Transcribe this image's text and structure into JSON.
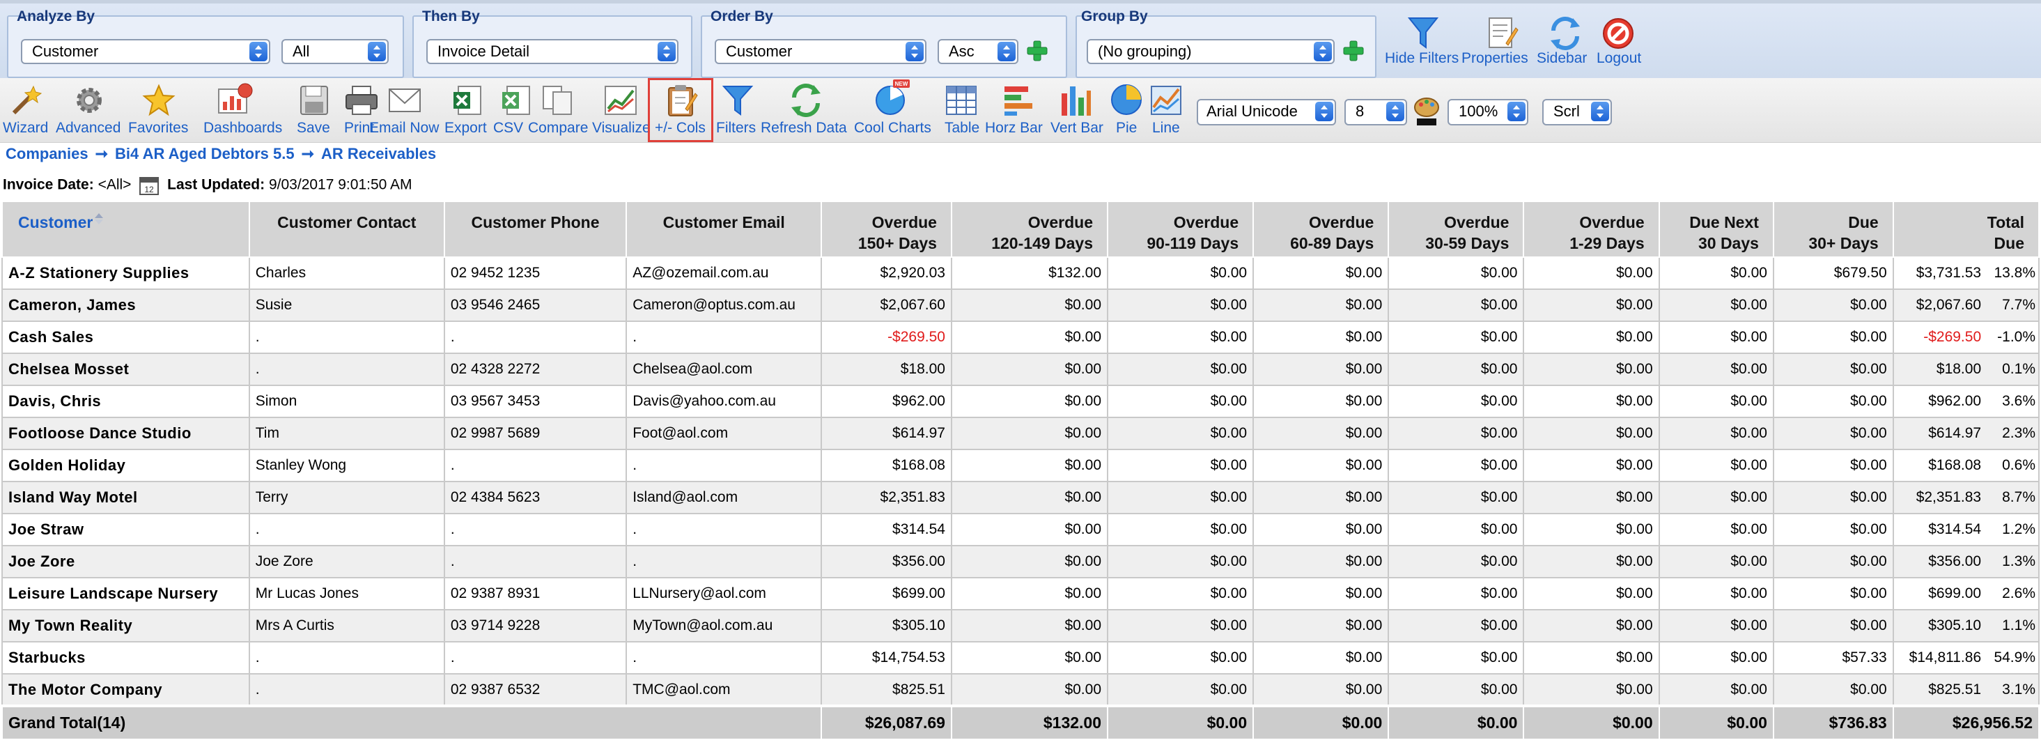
{
  "filters": {
    "analyze_by": {
      "title": "Analyze By",
      "field": "Customer",
      "value": "All"
    },
    "then_by": {
      "title": "Then By",
      "field": "Invoice Detail"
    },
    "order_by": {
      "title": "Order By",
      "field": "Customer",
      "direction": "Asc"
    },
    "group_by": {
      "title": "Group By",
      "field": "(No grouping)"
    }
  },
  "top_actions": [
    "Hide Filters",
    "Properties",
    "Sidebar",
    "Logout"
  ],
  "toolbar": {
    "wizard": "Wizard",
    "advanced": "Advanced",
    "favorites": "Favorites",
    "dashboards": "Dashboards",
    "save": "Save",
    "print": "Print",
    "email_now": "Email Now",
    "export": "Export",
    "csv": "CSV",
    "compare": "Compare",
    "visualize": "Visualize",
    "cols": "+/- Cols",
    "filters": "Filters",
    "refresh": "Refresh Data",
    "cool_charts": "Cool Charts",
    "table": "Table",
    "horz_bar": "Horz Bar",
    "vert_bar": "Vert Bar",
    "pie": "Pie",
    "line": "Line",
    "font": "Arial Unicode",
    "font_size": "8",
    "zoom": "100%",
    "scroll": "Scrl",
    "new_badge": "NEW"
  },
  "breadcrumb": [
    "Companies",
    "Bi4 AR Aged Debtors 5.5",
    "AR Receivables"
  ],
  "info": {
    "invoice_date_label": "Invoice Date:",
    "invoice_date_value": "<All>",
    "last_updated_label": "Last Updated:",
    "last_updated_value": "9/03/2017 9:01:50 AM"
  },
  "columns": [
    [
      "Customer"
    ],
    [
      "Customer Contact"
    ],
    [
      "Customer Phone"
    ],
    [
      "Customer Email"
    ],
    [
      "Overdue",
      "150+ Days"
    ],
    [
      "Overdue",
      "120-149 Days"
    ],
    [
      "Overdue",
      "90-119 Days"
    ],
    [
      "Overdue",
      "60-89 Days"
    ],
    [
      "Overdue",
      "30-59 Days"
    ],
    [
      "Overdue",
      "1-29 Days"
    ],
    [
      "Due Next",
      "30 Days"
    ],
    [
      "Due",
      "30+ Days"
    ],
    [
      "Total",
      "Due"
    ]
  ],
  "rows": [
    {
      "customer": "A-Z Stationery Supplies",
      "contact": "Charles",
      "phone": "02 9452 1235",
      "email": "AZ@ozemail.com.au",
      "d150": "$2,920.03",
      "d120": "$132.00",
      "d90": "$0.00",
      "d60": "$0.00",
      "d30": "$0.00",
      "d1": "$0.00",
      "next30": "$0.00",
      "due30": "$679.50",
      "total": "$3,731.53",
      "pct": "13.8%"
    },
    {
      "customer": "Cameron, James",
      "contact": "Susie",
      "phone": "03 9546 2465",
      "email": "Cameron@optus.com.au",
      "d150": "$2,067.60",
      "d120": "$0.00",
      "d90": "$0.00",
      "d60": "$0.00",
      "d30": "$0.00",
      "d1": "$0.00",
      "next30": "$0.00",
      "due30": "$0.00",
      "total": "$2,067.60",
      "pct": "7.7%"
    },
    {
      "customer": "Cash Sales",
      "contact": ".",
      "phone": ".",
      "email": ".",
      "d150": "-$269.50",
      "d120": "$0.00",
      "d90": "$0.00",
      "d60": "$0.00",
      "d30": "$0.00",
      "d1": "$0.00",
      "next30": "$0.00",
      "due30": "$0.00",
      "total": "-$269.50",
      "pct": "-1.0%",
      "negative": true
    },
    {
      "customer": "Chelsea Mosset",
      "contact": ".",
      "phone": "02 4328 2272",
      "email": "Chelsea@aol.com",
      "d150": "$18.00",
      "d120": "$0.00",
      "d90": "$0.00",
      "d60": "$0.00",
      "d30": "$0.00",
      "d1": "$0.00",
      "next30": "$0.00",
      "due30": "$0.00",
      "total": "$18.00",
      "pct": "0.1%"
    },
    {
      "customer": "Davis, Chris",
      "contact": "Simon",
      "phone": "03 9567 3453",
      "email": "Davis@yahoo.com.au",
      "d150": "$962.00",
      "d120": "$0.00",
      "d90": "$0.00",
      "d60": "$0.00",
      "d30": "$0.00",
      "d1": "$0.00",
      "next30": "$0.00",
      "due30": "$0.00",
      "total": "$962.00",
      "pct": "3.6%"
    },
    {
      "customer": "Footloose Dance Studio",
      "contact": "Tim",
      "phone": "02 9987 5689",
      "email": "Foot@aol.com",
      "d150": "$614.97",
      "d120": "$0.00",
      "d90": "$0.00",
      "d60": "$0.00",
      "d30": "$0.00",
      "d1": "$0.00",
      "next30": "$0.00",
      "due30": "$0.00",
      "total": "$614.97",
      "pct": "2.3%"
    },
    {
      "customer": "Golden Holiday",
      "contact": "Stanley Wong",
      "phone": ".",
      "email": ".",
      "d150": "$168.08",
      "d120": "$0.00",
      "d90": "$0.00",
      "d60": "$0.00",
      "d30": "$0.00",
      "d1": "$0.00",
      "next30": "$0.00",
      "due30": "$0.00",
      "total": "$168.08",
      "pct": "0.6%"
    },
    {
      "customer": "Island Way Motel",
      "contact": "Terry",
      "phone": "02 4384 5623",
      "email": "Island@aol.com",
      "d150": "$2,351.83",
      "d120": "$0.00",
      "d90": "$0.00",
      "d60": "$0.00",
      "d30": "$0.00",
      "d1": "$0.00",
      "next30": "$0.00",
      "due30": "$0.00",
      "total": "$2,351.83",
      "pct": "8.7%"
    },
    {
      "customer": "Joe Straw",
      "contact": ".",
      "phone": ".",
      "email": ".",
      "d150": "$314.54",
      "d120": "$0.00",
      "d90": "$0.00",
      "d60": "$0.00",
      "d30": "$0.00",
      "d1": "$0.00",
      "next30": "$0.00",
      "due30": "$0.00",
      "total": "$314.54",
      "pct": "1.2%"
    },
    {
      "customer": "Joe Zore",
      "contact": "Joe Zore",
      "phone": ".",
      "email": ".",
      "d150": "$356.00",
      "d120": "$0.00",
      "d90": "$0.00",
      "d60": "$0.00",
      "d30": "$0.00",
      "d1": "$0.00",
      "next30": "$0.00",
      "due30": "$0.00",
      "total": "$356.00",
      "pct": "1.3%"
    },
    {
      "customer": "Leisure Landscape Nursery",
      "contact": "Mr Lucas Jones",
      "phone": "02 9387 8931",
      "email": "LLNursery@aol.com",
      "d150": "$699.00",
      "d120": "$0.00",
      "d90": "$0.00",
      "d60": "$0.00",
      "d30": "$0.00",
      "d1": "$0.00",
      "next30": "$0.00",
      "due30": "$0.00",
      "total": "$699.00",
      "pct": "2.6%"
    },
    {
      "customer": "My Town Reality",
      "contact": "Mrs A Curtis",
      "phone": "03 9714 9228",
      "email": "MyTown@aol.com.au",
      "d150": "$305.10",
      "d120": "$0.00",
      "d90": "$0.00",
      "d60": "$0.00",
      "d30": "$0.00",
      "d1": "$0.00",
      "next30": "$0.00",
      "due30": "$0.00",
      "total": "$305.10",
      "pct": "1.1%"
    },
    {
      "customer": "Starbucks",
      "contact": ".",
      "phone": ".",
      "email": ".",
      "d150": "$14,754.53",
      "d120": "$0.00",
      "d90": "$0.00",
      "d60": "$0.00",
      "d30": "$0.00",
      "d1": "$0.00",
      "next30": "$0.00",
      "due30": "$57.33",
      "total": "$14,811.86",
      "pct": "54.9%"
    },
    {
      "customer": "The Motor Company",
      "contact": ".",
      "phone": "02 9387 6532",
      "email": "TMC@aol.com",
      "d150": "$825.51",
      "d120": "$0.00",
      "d90": "$0.00",
      "d60": "$0.00",
      "d30": "$0.00",
      "d1": "$0.00",
      "next30": "$0.00",
      "due30": "$0.00",
      "total": "$825.51",
      "pct": "3.1%"
    }
  ],
  "grand_total": {
    "label": "Grand Total(14)",
    "d150": "$26,087.69",
    "d120": "$132.00",
    "d90": "$0.00",
    "d60": "$0.00",
    "d30": "$0.00",
    "d1": "$0.00",
    "next30": "$0.00",
    "due30": "$736.83",
    "total": "$26,956.52"
  },
  "colors": {
    "link_blue": "#1c5fc7",
    "negative_red": "#e01b1b",
    "header_gray": "#d4d4d4",
    "highlight_red": "#e0403a"
  }
}
